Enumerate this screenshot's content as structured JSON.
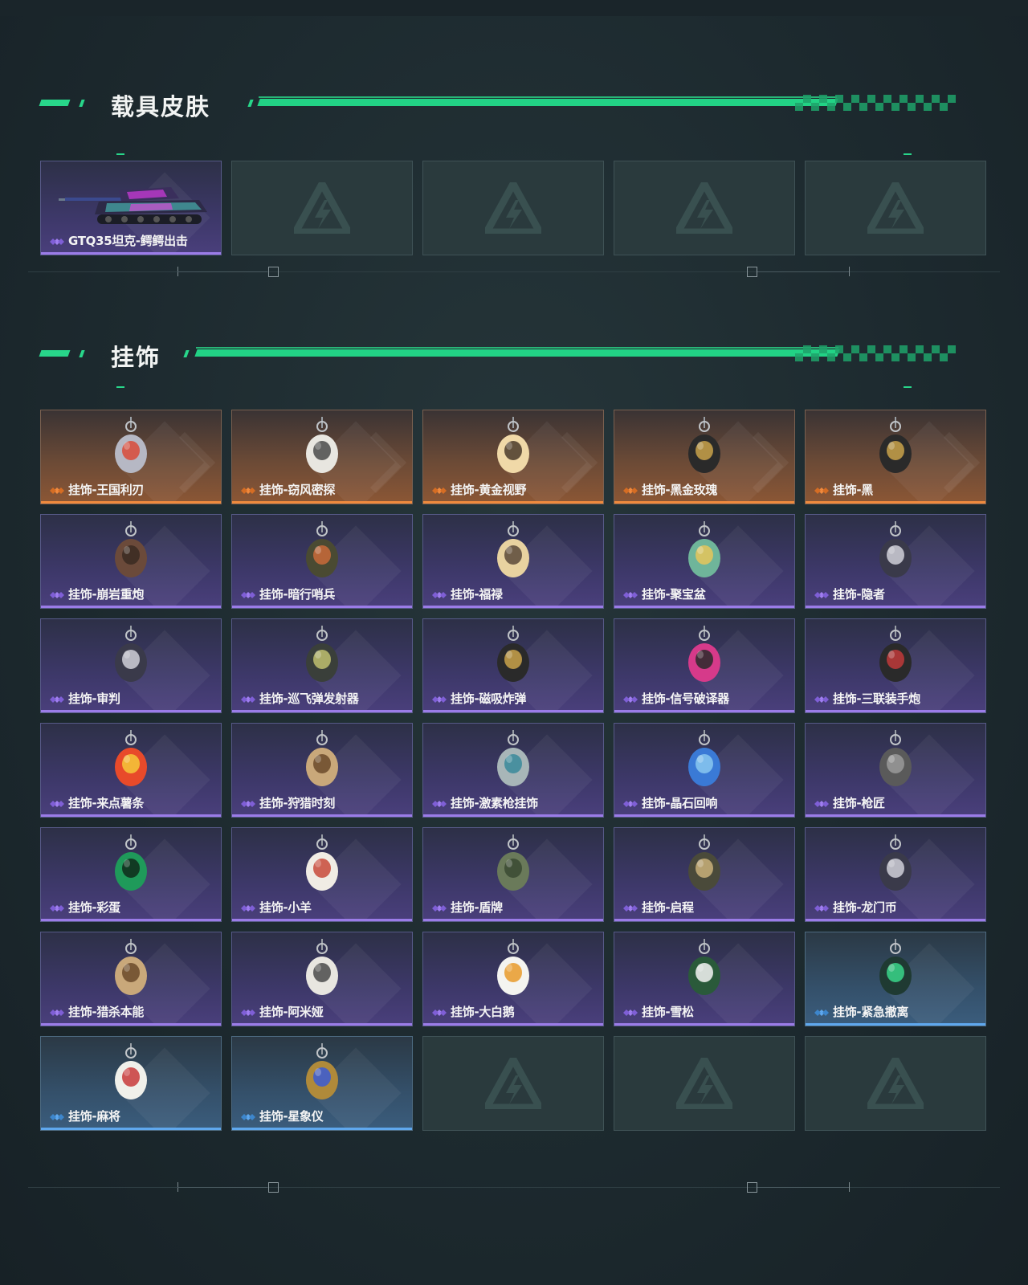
{
  "sections": {
    "vehicle": {
      "title": "载具皮肤"
    },
    "charms": {
      "title": "挂饰"
    }
  },
  "vehicle_cards": [
    {
      "label": "GTQ35坦克-鳄鳄出击",
      "rarity": "purple",
      "icon": "tank-skin-image"
    },
    {
      "label": null,
      "rarity": "empty"
    },
    {
      "label": null,
      "rarity": "empty"
    },
    {
      "label": null,
      "rarity": "empty"
    },
    {
      "label": null,
      "rarity": "empty"
    }
  ],
  "charm_cards": [
    {
      "label": "挂饰-王国利刃",
      "rarity": "orange",
      "icon": "knight-charm-image"
    },
    {
      "label": "挂饰-窃风密探",
      "rarity": "orange",
      "icon": "rabbit-charm-image"
    },
    {
      "label": "挂饰-黄金视野",
      "rarity": "orange",
      "icon": "fox-charm-image"
    },
    {
      "label": "挂饰-黑金玫瑰",
      "rarity": "orange",
      "icon": "black-rose-charm-image"
    },
    {
      "label": "挂饰-黑",
      "rarity": "orange",
      "icon": "black-card-charm-image"
    },
    {
      "label": "挂饰-崩岩重炮",
      "rarity": "purple",
      "icon": "bear-charm-image"
    },
    {
      "label": "挂饰-暗行哨兵",
      "rarity": "purple",
      "icon": "soldier-charm-image"
    },
    {
      "label": "挂饰-福禄",
      "rarity": "purple",
      "icon": "gourd-charm-image"
    },
    {
      "label": "挂饰-聚宝盆",
      "rarity": "purple",
      "icon": "treasure-bowl-charm-image"
    },
    {
      "label": "挂饰-隐者",
      "rarity": "purple",
      "icon": "hermit-card-charm-image"
    },
    {
      "label": "挂饰-审判",
      "rarity": "purple",
      "icon": "judgment-card-charm-image"
    },
    {
      "label": "挂饰-巡飞弹发射器",
      "rarity": "purple",
      "icon": "launcher-charm-image"
    },
    {
      "label": "挂饰-磁吸炸弹",
      "rarity": "purple",
      "icon": "magnetic-bomb-charm-image"
    },
    {
      "label": "挂饰-信号破译器",
      "rarity": "purple",
      "icon": "signal-decoder-charm-image"
    },
    {
      "label": "挂饰-三联装手炮",
      "rarity": "purple",
      "icon": "hand-cannon-charm-image"
    },
    {
      "label": "挂饰-来点薯条",
      "rarity": "purple",
      "icon": "fries-charm-image"
    },
    {
      "label": "挂饰-狩猎时刻",
      "rarity": "purple",
      "icon": "antlers-charm-image"
    },
    {
      "label": "挂饰-激素枪挂饰",
      "rarity": "purple",
      "icon": "stim-gun-charm-image"
    },
    {
      "label": "挂饰-晶石回响",
      "rarity": "purple",
      "icon": "crystal-charm-image"
    },
    {
      "label": "挂饰-枪匠",
      "rarity": "purple",
      "icon": "gunsmith-charm-image"
    },
    {
      "label": "挂饰-彩蛋",
      "rarity": "purple",
      "icon": "easter-egg-charm-image"
    },
    {
      "label": "挂饰-小羊",
      "rarity": "purple",
      "icon": "lamb-charm-image"
    },
    {
      "label": "挂饰-盾牌",
      "rarity": "purple",
      "icon": "shield-charm-image"
    },
    {
      "label": "挂饰-启程",
      "rarity": "purple",
      "icon": "compass-charm-image"
    },
    {
      "label": "挂饰-龙门币",
      "rarity": "purple",
      "icon": "coin-card-charm-image"
    },
    {
      "label": "挂饰-猎杀本能",
      "rarity": "purple",
      "icon": "antlers-charm-image"
    },
    {
      "label": "挂饰-阿米娅",
      "rarity": "purple",
      "icon": "amiya-charm-image"
    },
    {
      "label": "挂饰-大白鹅",
      "rarity": "purple",
      "icon": "goose-charm-image"
    },
    {
      "label": "挂饰-雪松",
      "rarity": "purple",
      "icon": "snow-pine-charm-image"
    },
    {
      "label": "挂饰-紧急撤离",
      "rarity": "blue",
      "icon": "evac-sign-charm-image"
    },
    {
      "label": "挂饰-麻将",
      "rarity": "blue",
      "icon": "mahjong-charm-image"
    },
    {
      "label": "挂饰-星象仪",
      "rarity": "blue",
      "icon": "astrolabe-charm-image"
    },
    {
      "label": null,
      "rarity": "empty"
    },
    {
      "label": null,
      "rarity": "empty"
    },
    {
      "label": null,
      "rarity": "empty"
    }
  ],
  "colors": {
    "accent_green": "#28d68a",
    "rarity_orange": "#f08a3e",
    "rarity_purple": "#9b7ce8",
    "rarity_blue": "#5fa8ee"
  }
}
